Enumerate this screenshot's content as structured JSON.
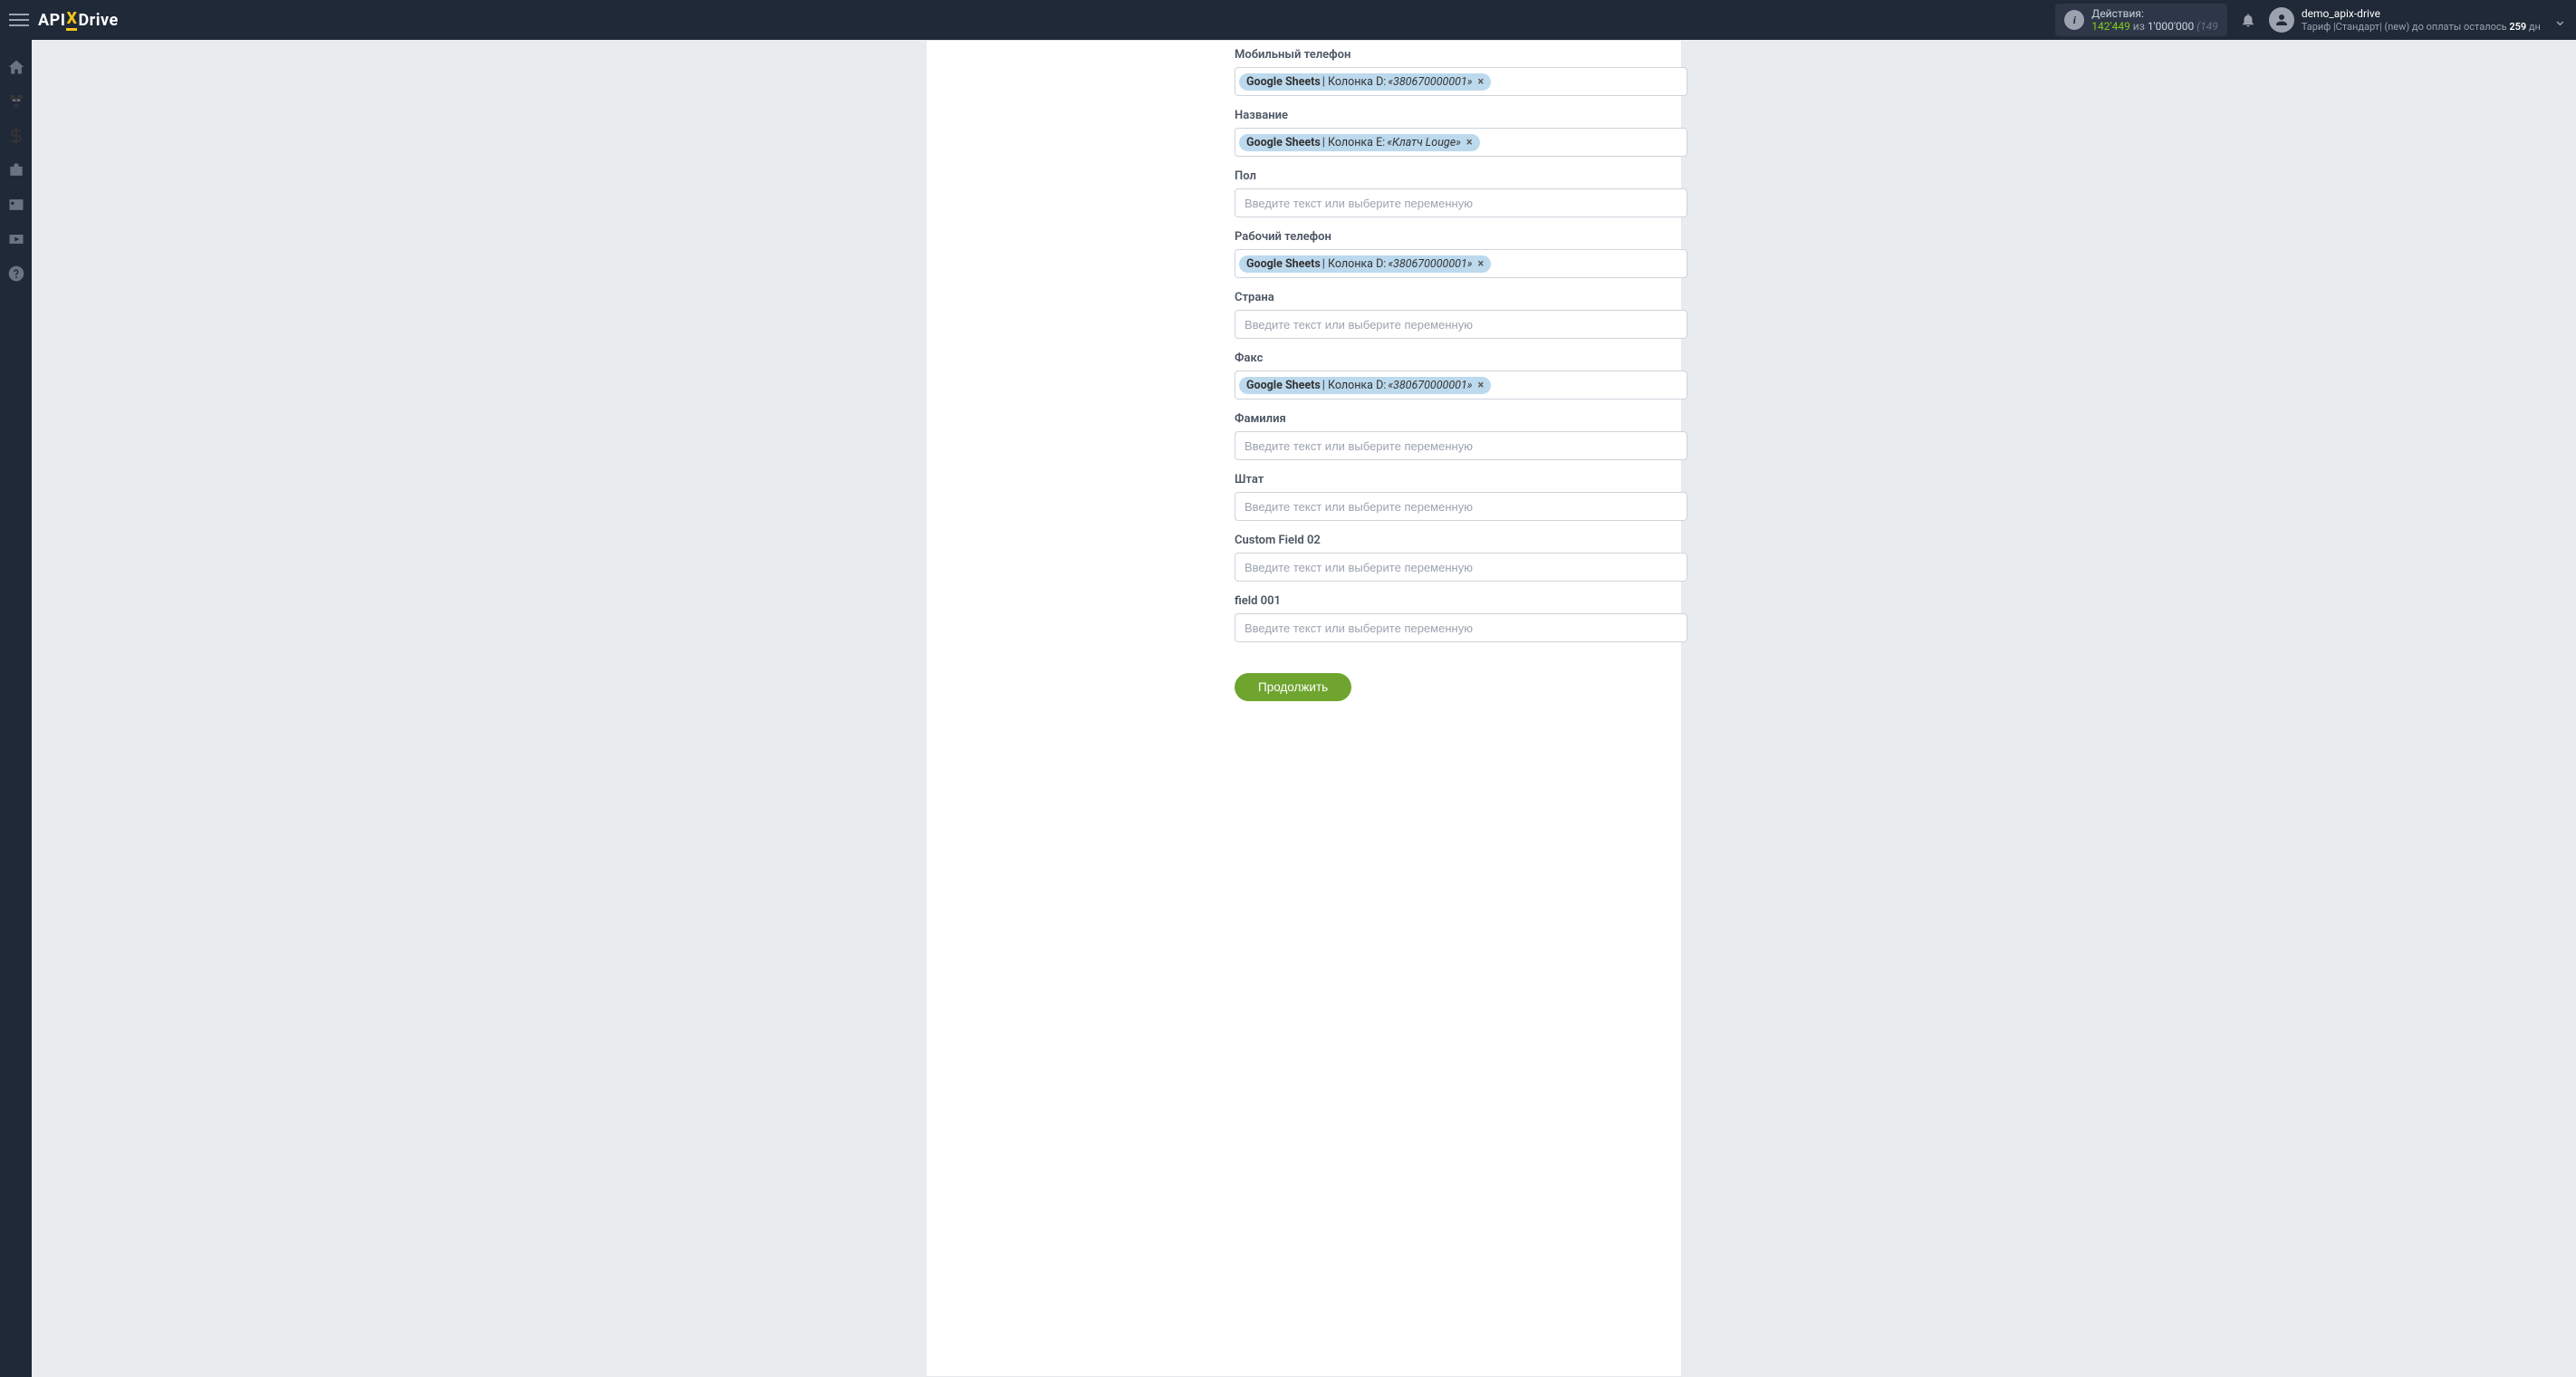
{
  "header": {
    "logo_parts": {
      "api": "API",
      "x": "X",
      "drive": "Drive"
    },
    "actions": {
      "label": "Действия:",
      "count": "142'449",
      "of": "из",
      "total": "1'000'000",
      "paren": "(149"
    },
    "user": {
      "name": "demo_apix-drive",
      "tariff_prefix": "Тариф |Стандарт| (new) до оплаты осталось ",
      "days": "259",
      "days_suffix": " дн"
    }
  },
  "form": {
    "placeholder": "Введите текст или выберите переменную",
    "continue": "Продолжить",
    "fields": [
      {
        "label": "Мобильный телефон",
        "tag": {
          "src": "Google Sheets",
          "col": " | Колонка D: ",
          "val": "«380670000001»"
        }
      },
      {
        "label": "Название",
        "tag": {
          "src": "Google Sheets",
          "col": " | Колонка E: ",
          "val": "«Клатч Louge»"
        }
      },
      {
        "label": "Пол",
        "tag": null
      },
      {
        "label": "Рабочий телефон",
        "tag": {
          "src": "Google Sheets",
          "col": " | Колонка D: ",
          "val": "«380670000001»"
        }
      },
      {
        "label": "Страна",
        "tag": null
      },
      {
        "label": "Факс",
        "tag": {
          "src": "Google Sheets",
          "col": " | Колонка D: ",
          "val": "«380670000001»"
        }
      },
      {
        "label": "Фамилия",
        "tag": null
      },
      {
        "label": "Штат",
        "tag": null
      },
      {
        "label": "Custom Field 02",
        "tag": null
      },
      {
        "label": "field 001",
        "tag": null
      }
    ]
  }
}
